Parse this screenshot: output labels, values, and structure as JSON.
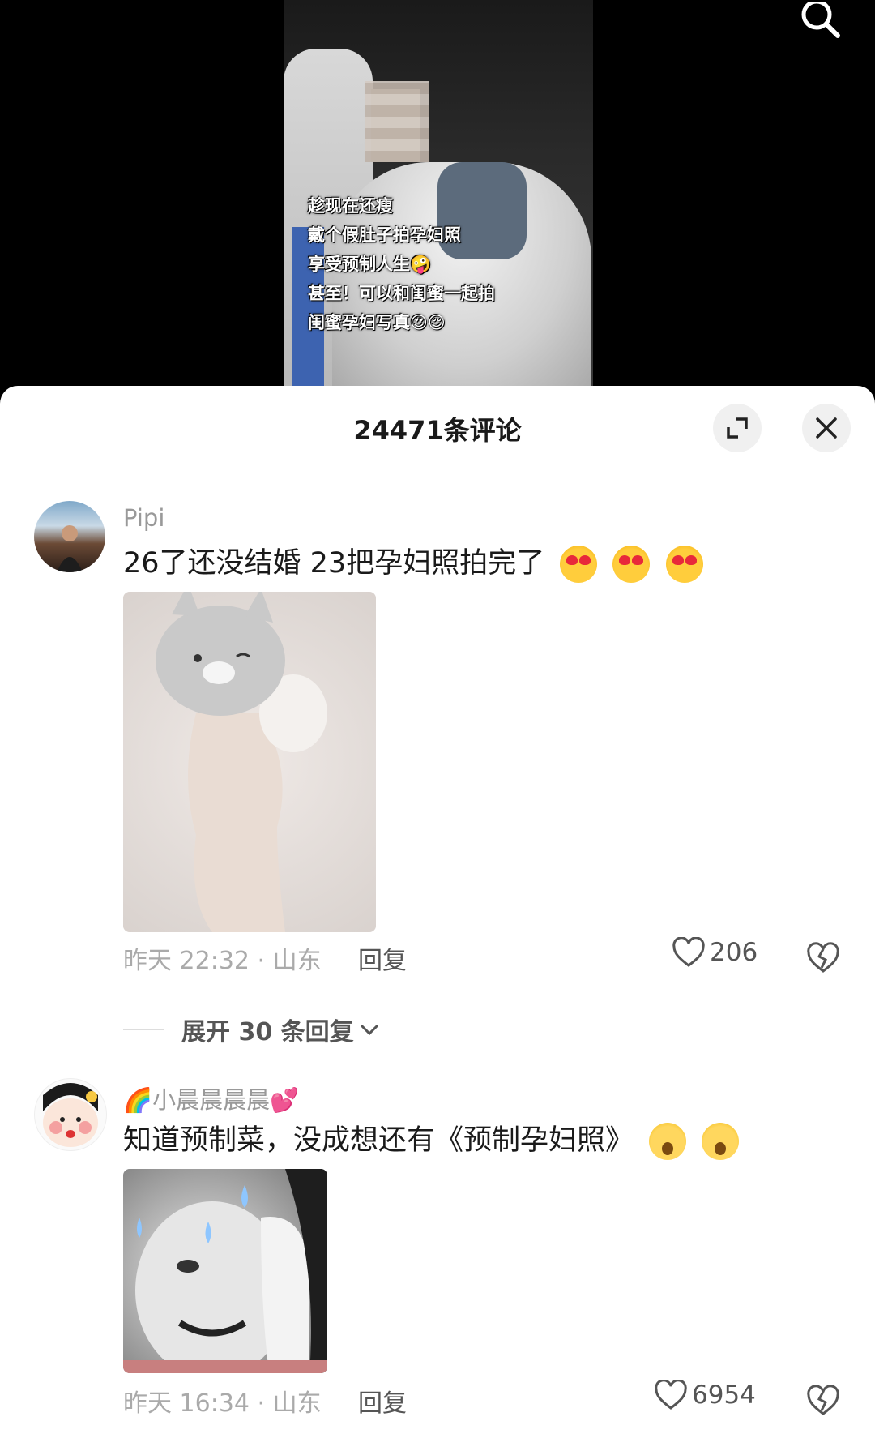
{
  "video": {
    "caption_lines": [
      "趁现在还瘦",
      "戴个假肚子拍孕妇照",
      "享受预制人生🤪",
      "甚至！可以和闺蜜一起拍",
      "闺蜜孕妇写真😍😌"
    ]
  },
  "sheet": {
    "title": "24471条评论"
  },
  "comments": [
    {
      "username": "Pipi",
      "text": "26了还没结婚 23把孕妇照拍完了",
      "emoji": [
        "smiling-face-with-heart-eyes",
        "smiling-face-with-heart-eyes",
        "smiling-face-with-heart-eyes"
      ],
      "meta": "昨天 22:32 · 山东",
      "reply_label": "回复",
      "likes": "206"
    },
    {
      "username": "🌈小晨晨晨晨💕",
      "text": "知道预制菜，没成想还有《预制孕妇照》",
      "emoji": [
        "astonished-face",
        "astonished-face"
      ],
      "meta": "昨天 16:34 · 山东",
      "reply_label": "回复",
      "likes": "6954"
    }
  ],
  "expand_replies": {
    "label": "展开 30 条回复"
  }
}
